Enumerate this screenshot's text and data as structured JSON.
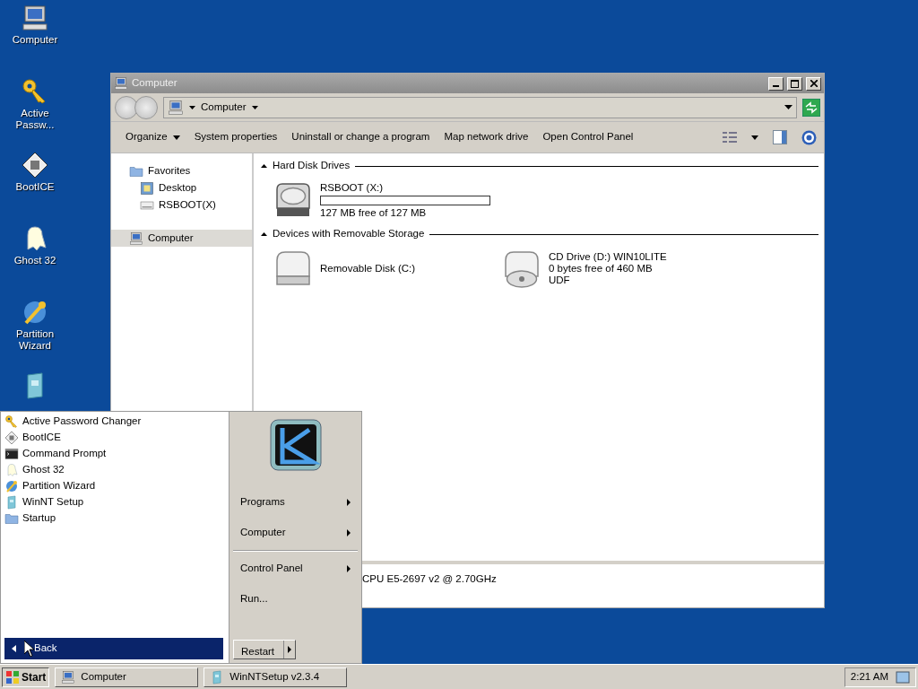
{
  "desktop_icons": [
    {
      "kind": "computer",
      "label": "Computer"
    },
    {
      "kind": "key",
      "label": "Active Passw..."
    },
    {
      "kind": "bootice",
      "label": "BootICE"
    },
    {
      "kind": "ghost",
      "label": "Ghost 32"
    },
    {
      "kind": "wizard",
      "label": "Partition Wizard"
    },
    {
      "kind": "setup"
    }
  ],
  "explorer": {
    "title": "Computer",
    "address": "Computer",
    "toolbar": [
      {
        "label": "Organize",
        "menu": true
      },
      {
        "label": "System properties",
        "menu": false
      },
      {
        "label": "Uninstall or change a program",
        "menu": false
      },
      {
        "label": "Map network drive",
        "menu": false
      },
      {
        "label": "Open Control Panel",
        "menu": false
      }
    ],
    "nav": [
      {
        "kind": "favorites",
        "label": "Favorites",
        "selected": false,
        "children": [
          {
            "kind": "desktop",
            "label": "Desktop",
            "selected": false
          },
          {
            "kind": "drive",
            "label": "RSBOOT(X)",
            "selected": false
          }
        ]
      },
      {
        "kind": "computer",
        "label": "Computer",
        "selected": true
      }
    ],
    "groups": [
      {
        "title": "Hard Disk Drives",
        "drives": [
          {
            "kind": "hdd",
            "name": "RSBOOT (X:)",
            "level": 0,
            "details": [
              "127 MB free of 127 MB"
            ]
          }
        ]
      },
      {
        "title": "Devices with Removable Storage",
        "drives": [
          {
            "kind": "removable",
            "name": "Removable Disk (C:)"
          },
          {
            "kind": "cd",
            "name": "CD Drive (D:) WIN10LITE",
            "details": [
              "0 bytes free of 460 MB",
              "UDF"
            ]
          }
        ]
      }
    ],
    "details_pane": "CPU E5-2697 v2 @ 2.70GHz"
  },
  "start_menu": {
    "programs": [
      {
        "kind": "key",
        "label": "Active Password Changer"
      },
      {
        "kind": "bootice",
        "label": "BootICE"
      },
      {
        "kind": "cmd",
        "label": "Command Prompt"
      },
      {
        "kind": "ghost",
        "label": "Ghost 32"
      },
      {
        "kind": "wizard",
        "label": "Partition Wizard"
      },
      {
        "kind": "setup",
        "label": "WinNT Setup"
      },
      {
        "kind": "folder",
        "label": "Startup"
      }
    ],
    "back": "Back",
    "right_groups": [
      [
        {
          "label": "Programs",
          "submenu": true
        },
        {
          "label": "Computer",
          "submenu": true
        }
      ],
      [
        {
          "label": "Control Panel",
          "submenu": true
        },
        {
          "label": "Run...",
          "submenu": false
        }
      ]
    ],
    "restart": "Restart"
  },
  "taskbar": {
    "start": "Start",
    "tasks": [
      {
        "kind": "computer",
        "label": "Computer"
      },
      {
        "kind": "setup",
        "label": "WinNTSetup v2.3.4"
      }
    ],
    "clock": "2:21 AM"
  }
}
